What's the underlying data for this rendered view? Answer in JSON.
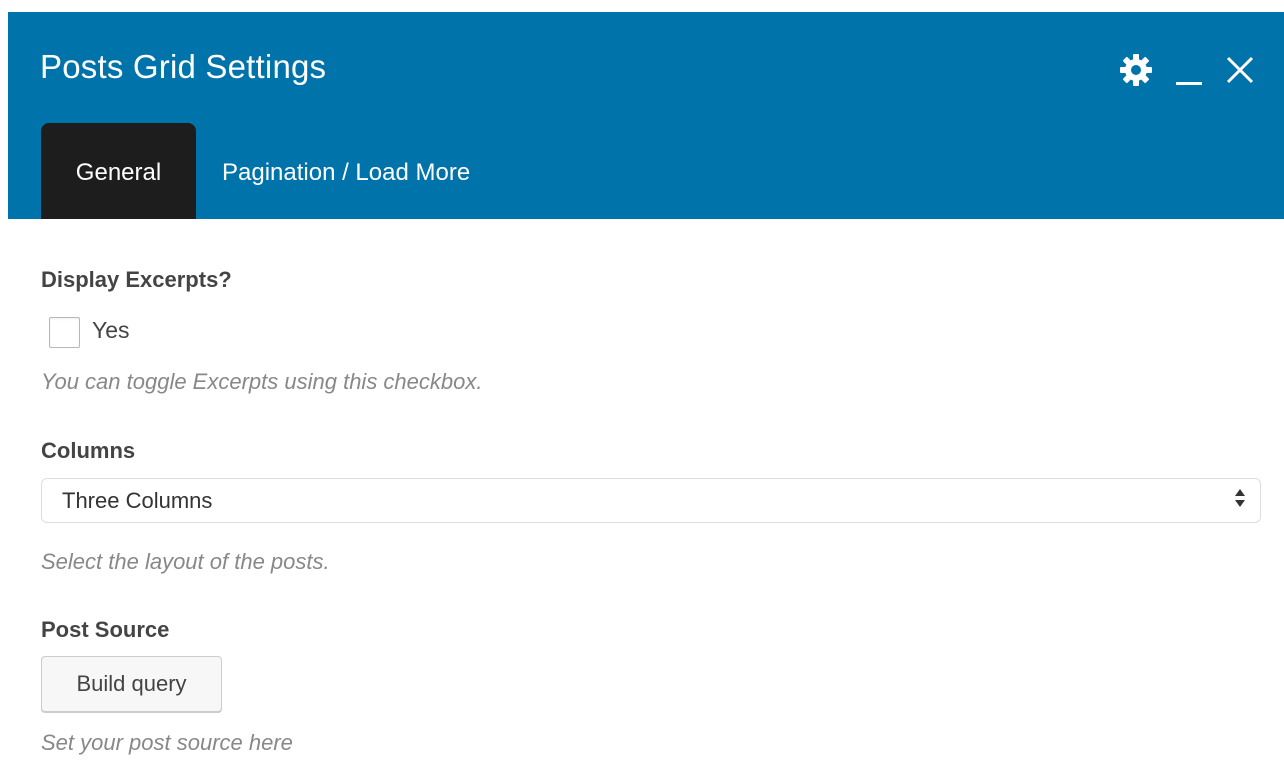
{
  "header": {
    "title": "Posts Grid Settings",
    "bg_color": "#0073aa",
    "controls": [
      {
        "icon": "gear-icon"
      },
      {
        "icon": "minimize-icon"
      },
      {
        "icon": "close-icon"
      }
    ]
  },
  "tabs": [
    {
      "label": "General",
      "active": true
    },
    {
      "label": "Pagination / Load More",
      "active": false
    }
  ],
  "fields": {
    "excerpts": {
      "label": "Display Excerpts?",
      "checkbox_label": "Yes",
      "checked": false,
      "help": "You can toggle Excerpts using this checkbox."
    },
    "columns": {
      "label": "Columns",
      "selected": "Three Columns",
      "help": "Select the layout of the posts."
    },
    "post_source": {
      "label": "Post Source",
      "button_label": "Build query",
      "help": "Set your post source here"
    }
  }
}
